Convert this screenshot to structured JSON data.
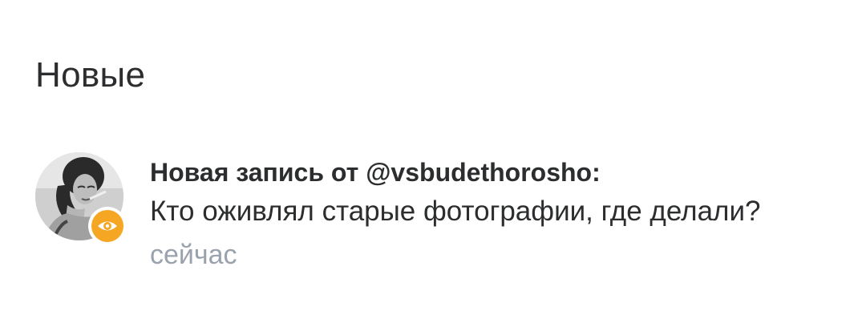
{
  "section": {
    "title": "Новые"
  },
  "notification": {
    "headline": "Новая запись от @vsbudethorosho:",
    "text": "Кто оживлял старые фотографии, где делали?",
    "time": "сейчас",
    "avatar_icon": "user-avatar-photo",
    "badge_icon": "eye-icon",
    "badge_color": "#f5a623"
  }
}
